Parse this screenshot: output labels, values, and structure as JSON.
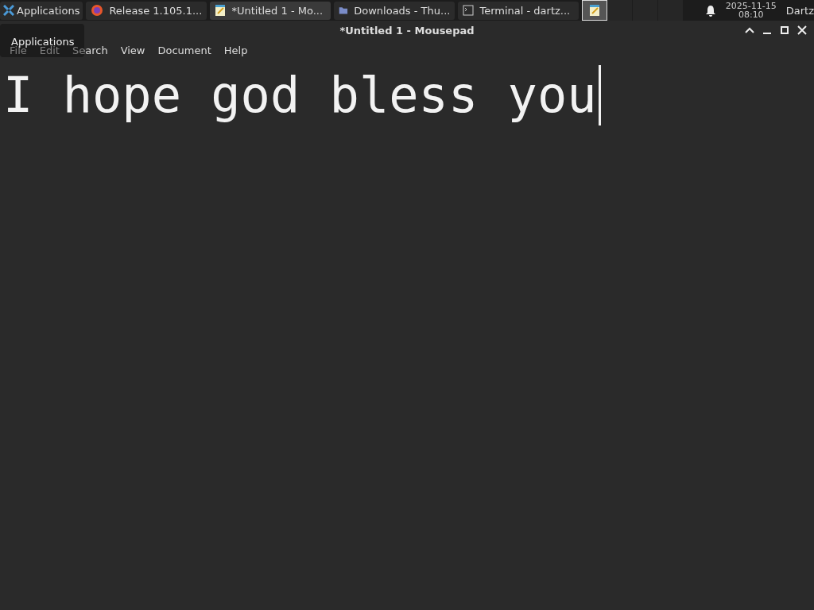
{
  "taskbar": {
    "app_menu": {
      "label": "Applications"
    },
    "windows": [
      {
        "label": "Release 1.105.1...",
        "kind": "browser",
        "selected": false
      },
      {
        "label": "*Untitled 1 - Mo...",
        "kind": "editor",
        "selected": true
      },
      {
        "label": "Downloads - Thu...",
        "kind": "folder",
        "selected": false
      },
      {
        "label": "Terminal - dartz...",
        "kind": "terminal",
        "selected": false
      }
    ],
    "workspaces": [
      {
        "selected": true
      },
      {
        "selected": false
      },
      {
        "selected": false
      },
      {
        "selected": false
      }
    ],
    "clock": {
      "date": "2025-11-15",
      "time": "08:10"
    },
    "user": "Dartz"
  },
  "tooltip": "Applications",
  "window": {
    "title": "*Untitled 1 - Mousepad"
  },
  "menu": [
    "File",
    "Edit",
    "Search",
    "View",
    "Document",
    "Help"
  ],
  "editor": {
    "text": "I hope god bless you"
  }
}
